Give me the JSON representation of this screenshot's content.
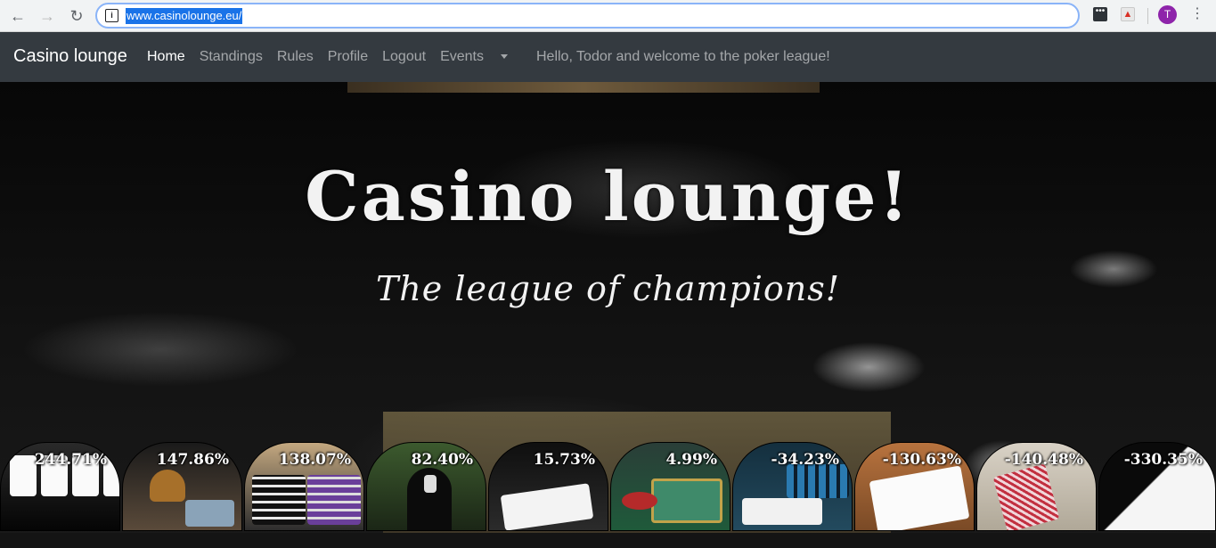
{
  "browser": {
    "url": "www.casinolounge.eu/",
    "profile_initial": "T",
    "icons": [
      "back-arrow-icon",
      "forward-arrow-icon",
      "reload-icon",
      "site-info-icon",
      "extension-icon",
      "pdf-extension-icon",
      "profile-avatar",
      "more-menu-icon"
    ]
  },
  "navbar": {
    "brand": "Casino lounge",
    "links": [
      {
        "label": "Home",
        "active": true
      },
      {
        "label": "Standings",
        "active": false
      },
      {
        "label": "Rules",
        "active": false
      },
      {
        "label": "Profile",
        "active": false
      },
      {
        "label": "Logout",
        "active": false
      }
    ],
    "events_label": "Events",
    "greeting": "Hello, Todor and welcome to the poker league!"
  },
  "hero": {
    "title": "Casino lounge!",
    "subtitle": "The league of champions!"
  },
  "players": [
    {
      "pct": "244.71%",
      "theme": "cards-row"
    },
    {
      "pct": "147.86%",
      "theme": "glass-chips"
    },
    {
      "pct": "138.07%",
      "theme": "chip-stacks"
    },
    {
      "pct": "82.40%",
      "theme": "hooded-figure"
    },
    {
      "pct": "15.73%",
      "theme": "aces-table"
    },
    {
      "pct": "4.99%",
      "theme": "green-felt"
    },
    {
      "pct": "-34.23%",
      "theme": "blue-chips"
    },
    {
      "pct": "-130.63%",
      "theme": "four-aces"
    },
    {
      "pct": "-140.48%",
      "theme": "red-deck"
    },
    {
      "pct": "-330.35%",
      "theme": "ace-card"
    }
  ],
  "colors": {
    "navbar": "#343a40",
    "url_highlight": "#1a73e8",
    "profile": "#8e24aa"
  }
}
